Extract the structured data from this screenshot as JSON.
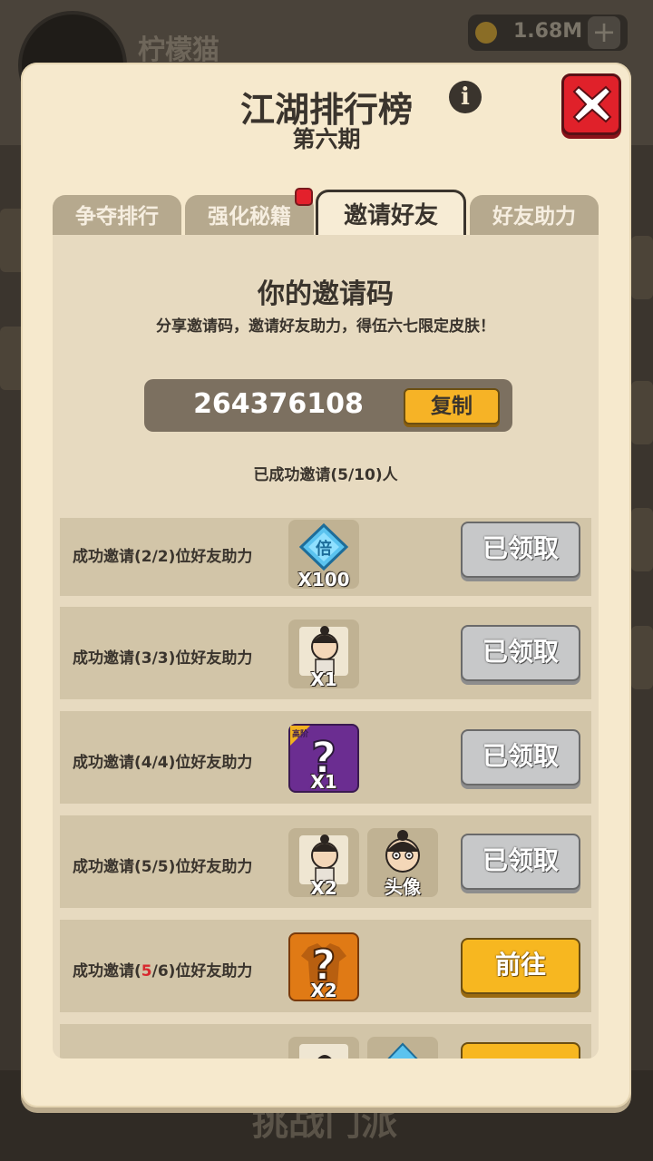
{
  "background": {
    "player_name": "柠檬猫",
    "coins": "1.68M",
    "bottom_label": "挑战门派"
  },
  "dialog": {
    "title": "江湖排行榜",
    "subtitle": "第六期",
    "tabs": [
      {
        "label": "争夺排行",
        "active": false
      },
      {
        "label": "强化秘籍",
        "active": false,
        "badge": true
      },
      {
        "label": "邀请好友",
        "active": true
      },
      {
        "label": "好友助力",
        "active": false
      }
    ],
    "invite": {
      "heading": "你的邀请码",
      "description": "分享邀请码，邀请好友助力，得伍六七限定皮肤！",
      "code": "264376108",
      "copy_label": "复制",
      "invited_status": "已成功邀请(5/10)人"
    },
    "rewards": [
      {
        "label": "成功邀请(2/2)位好友助力",
        "items": [
          {
            "icon": "diamond-multiplier-icon",
            "icon_text": "倍",
            "qty": "X100"
          }
        ],
        "button": "已领取",
        "claimed": true
      },
      {
        "label": "成功邀请(3/3)位好友助力",
        "items": [
          {
            "icon": "character-fragment-icon",
            "qty": "X1"
          }
        ],
        "button": "已领取",
        "claimed": true
      },
      {
        "label": "成功邀请(4/4)位好友助力",
        "items": [
          {
            "icon": "mystery-box-purple-icon",
            "corner": "高阶",
            "qty": "X1"
          }
        ],
        "button": "已领取",
        "claimed": true
      },
      {
        "label": "成功邀请(5/5)位好友助力",
        "items": [
          {
            "icon": "character-fragment-icon",
            "qty": "X2"
          },
          {
            "icon": "avatar-icon",
            "qty": "头像"
          }
        ],
        "button": "已领取",
        "claimed": true
      },
      {
        "label_prefix": "成功邀请(",
        "label_highlight": "5",
        "label_suffix": "/6)位好友助力",
        "items": [
          {
            "icon": "mystery-shirt-orange-icon",
            "qty": "X2"
          }
        ],
        "button": "前往",
        "claimed": false
      }
    ]
  },
  "colors": {
    "dialog_bg": "#f6e9cd",
    "panel_bg": "#e7dac0",
    "row_bg": "#d2c5a8",
    "go_button": "#f7b720",
    "claimed_button": "#c7c8c9",
    "close_button": "#e0212a"
  }
}
